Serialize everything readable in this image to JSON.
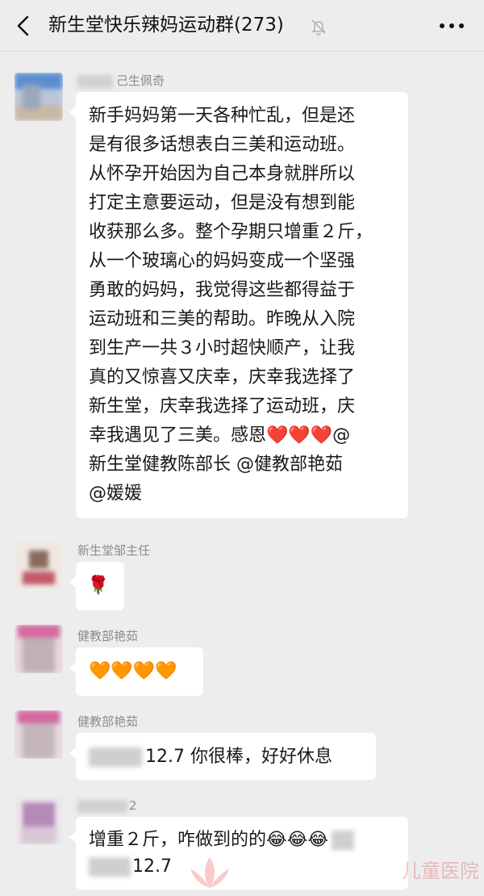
{
  "header": {
    "title": "新生堂快乐辣妈运动群(273)",
    "back_icon": "chevron-left-icon",
    "mute_icon": "bell-slash-icon",
    "more_icon": "more-dots-icon"
  },
  "messages": [
    {
      "sender": "己生佩奇",
      "lines": [
        "新手妈妈第一天各种忙乱，但是还",
        "是有很多话想表白三美和运动班。",
        "从怀孕开始因为自己本身就胖所以",
        "打定主意要运动，但是没有想到能",
        "收获那么多。整个孕期只增重２斤，",
        "从一个玻璃心的妈妈变成一个坚强",
        "勇敢的妈妈，我觉得这些都得益于",
        "运动班和三美的帮助。昨晚从入院",
        "到生产一共３小时超快顺产，让我",
        "真的又惊喜又庆幸，庆幸我选择了",
        "新生堂，庆幸我选择了运动班，庆",
        "幸我遇见了三美。感恩❤️❤️❤️@",
        "新生堂健教陈部长  @健教部艳茹",
        "@媛媛"
      ]
    },
    {
      "sender": "新生堂邹主任",
      "content": "🌹"
    },
    {
      "sender": "健教部艳茹",
      "content": "🧡🧡🧡🧡"
    },
    {
      "sender": "健教部艳茹",
      "content": "12.7  你很棒，好好休息"
    },
    {
      "sender": "2",
      "lines": [
        "增重２斤，咋做到的的😂😂😂",
        "12.7"
      ]
    }
  ],
  "watermark": "儿童医院",
  "colors": {
    "background": "#ededed",
    "bubble": "#ffffff",
    "sender": "#8c8c8c"
  }
}
